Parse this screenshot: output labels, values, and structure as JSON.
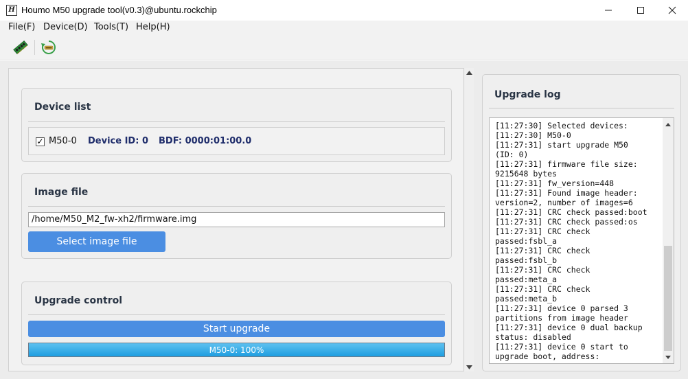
{
  "window": {
    "title": "Houmo M50 upgrade tool(v0.3)@ubuntu.rockchip",
    "app_icon_glyph": "H"
  },
  "menu": {
    "items": [
      {
        "label": "File(F)"
      },
      {
        "label": "Device(D)"
      },
      {
        "label": "Tools(T)"
      },
      {
        "label": "Help(H)"
      }
    ]
  },
  "toolbar": {
    "icons": [
      "memory-chip-icon",
      "reset-icon"
    ]
  },
  "device_list": {
    "title": "Device list",
    "device": {
      "checked": true,
      "check_glyph": "✓",
      "name": "M50-0",
      "id_text": "Device ID: 0",
      "bdf_text": "BDF: 0000:01:00.0"
    }
  },
  "image_file": {
    "title": "Image file",
    "path": "/home/M50_M2_fw-xh2/firmware.img",
    "select_button": "Select image file"
  },
  "upgrade_control": {
    "title": "Upgrade control",
    "start_button": "Start upgrade",
    "progress_label": "M50-0: 100%",
    "progress_value": 1.0
  },
  "upgrade_log": {
    "title": "Upgrade log",
    "lines": [
      "[11:27:30] Selected devices:",
      "[11:27:30] M50-0",
      "[11:27:31] start upgrade M50",
      "(ID: 0)",
      "[11:27:31] firmware file size:",
      "9215648 bytes",
      "[11:27:31] fw_version=448",
      "[11:27:31] Found image header:",
      "version=2, number of images=6",
      "[11:27:31] CRC check passed:boot",
      "[11:27:31] CRC check passed:os",
      "[11:27:31] CRC check",
      "passed:fsbl_a",
      "[11:27:31] CRC check",
      "passed:fsbl_b",
      "[11:27:31] CRC check",
      "passed:meta_a",
      "[11:27:31] CRC check",
      "passed:meta_b",
      "[11:27:31] device 0 parsed 3",
      "partitions from image header",
      "[11:27:31] device 0 dual backup",
      "status: disabled",
      "[11:27:31] device 0 start to",
      "upgrade boot, address:"
    ]
  },
  "colors": {
    "accent_button": "#4b8ee2",
    "progress_fill": "#1e9ee0",
    "group_title": "#2a3545",
    "device_info": "#1f2d6b"
  }
}
